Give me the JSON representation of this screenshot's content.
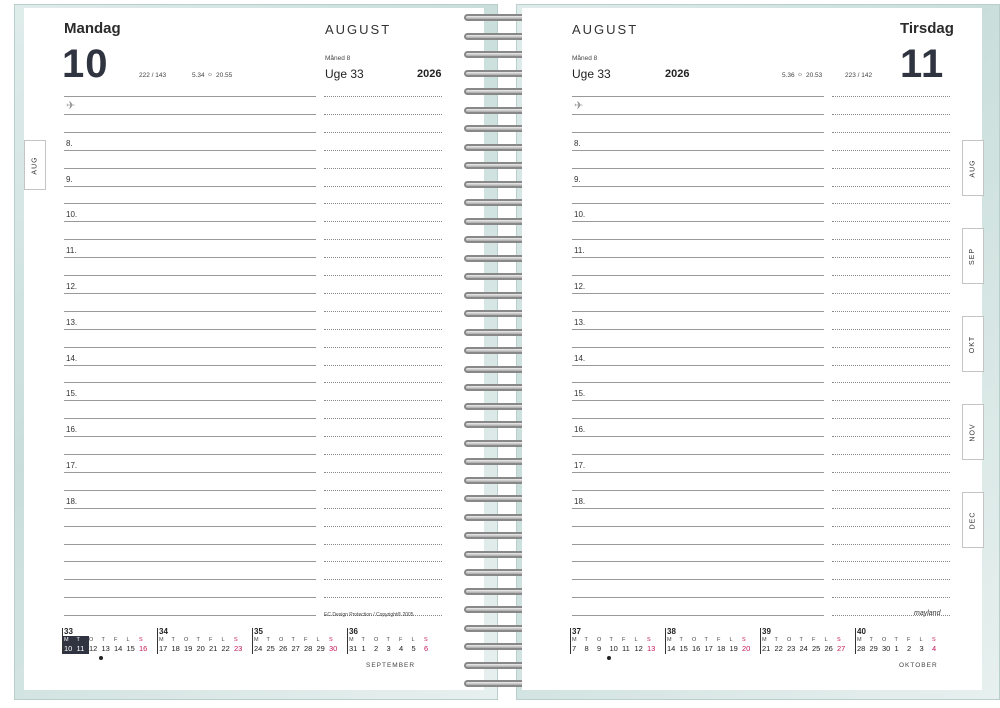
{
  "left_page": {
    "day_name": "Mandag",
    "day_number": "10",
    "day_count": "222 / 143",
    "sunrise": "5.34",
    "sunset": "20.55",
    "month": "AUGUST",
    "month_number": "Måned 8",
    "week": "Uge 33",
    "year": "2026",
    "hours": [
      "8.",
      "9.",
      "10.",
      "11.",
      "12.",
      "13.",
      "14.",
      "15.",
      "16.",
      "17.",
      "18."
    ],
    "footer": "EC Design Protection / Copyright® 2005",
    "tab": "AUG",
    "mini_calendar": {
      "weeks": [
        {
          "num": "33",
          "days": [
            "10",
            "11",
            "12",
            "13",
            "14",
            "15",
            "16"
          ]
        },
        {
          "num": "34",
          "days": [
            "17",
            "18",
            "19",
            "20",
            "21",
            "22",
            "23"
          ]
        },
        {
          "num": "35",
          "days": [
            "24",
            "25",
            "26",
            "27",
            "28",
            "29",
            "30"
          ]
        },
        {
          "num": "36",
          "days": [
            "31",
            "1",
            "2",
            "3",
            "4",
            "5",
            "6"
          ]
        }
      ],
      "next_month": "SEPTEMBER"
    }
  },
  "right_page": {
    "day_name": "Tirsdag",
    "day_number": "11",
    "day_count": "223 / 142",
    "sunrise": "5.36",
    "sunset": "20.53",
    "month": "AUGUST",
    "month_number": "Måned 8",
    "week": "Uge 33",
    "year": "2026",
    "hours": [
      "8.",
      "9.",
      "10.",
      "11.",
      "12.",
      "13.",
      "14.",
      "15.",
      "16.",
      "17.",
      "18."
    ],
    "brand": "mayland",
    "tabs": [
      "AUG",
      "SEP",
      "OKT",
      "NOV",
      "DEC"
    ],
    "mini_calendar": {
      "weeks": [
        {
          "num": "37",
          "days": [
            "7",
            "8",
            "9",
            "10",
            "11",
            "12",
            "13"
          ]
        },
        {
          "num": "38",
          "days": [
            "14",
            "15",
            "16",
            "17",
            "18",
            "19",
            "20"
          ]
        },
        {
          "num": "39",
          "days": [
            "21",
            "22",
            "23",
            "24",
            "25",
            "26",
            "27"
          ]
        },
        {
          "num": "40",
          "days": [
            "28",
            "29",
            "30",
            "1",
            "2",
            "3",
            "4"
          ]
        }
      ],
      "next_month": "OKTOBER"
    }
  },
  "weekday_initials": "MTOTFLS",
  "colors": {
    "accent_red": "#c2185b",
    "cover": "#c9dedb",
    "number": "#2f3440"
  }
}
